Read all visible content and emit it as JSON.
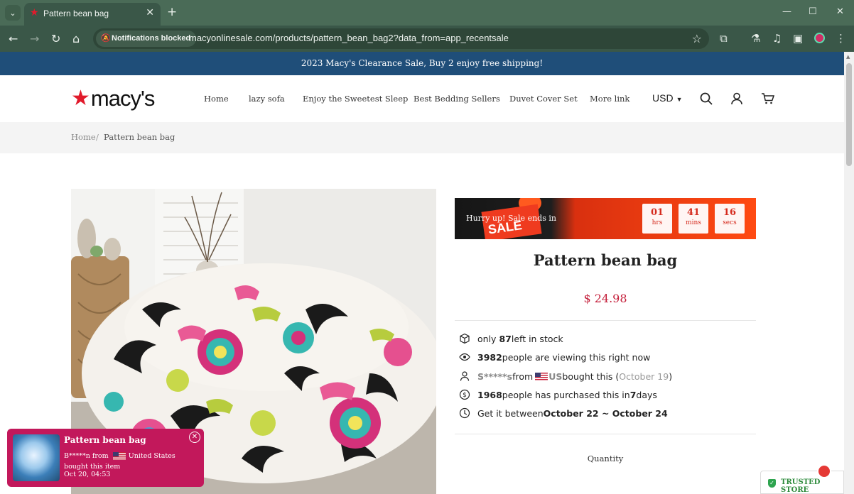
{
  "browser": {
    "tab_title": "Pattern bean bag",
    "notifications_chip": "Notifications blocked",
    "url": "macyonlinesale.com/products/pattern_bean_bag2?data_from=app_recentsale"
  },
  "announcement": "2023 Macy's Clearance Sale, Buy 2 enjoy free shipping!",
  "header": {
    "logo_text": "macy's",
    "nav": [
      "Home",
      "lazy sofa",
      "Enjoy the Sweetest Sleep",
      "Best Bedding Sellers",
      "Duvet Cover Set",
      "More link"
    ],
    "currency": "USD"
  },
  "breadcrumb": {
    "home": "Home",
    "separator": "/",
    "current": "Pattern bean bag"
  },
  "countdown": {
    "text": "Hurry up!  Sale ends in",
    "sale_word": "SALE",
    "hours": "01",
    "hours_label": "hrs",
    "mins": "41",
    "mins_label": "mins",
    "secs": "16",
    "secs_label": "secs"
  },
  "product": {
    "title": "Pattern bean bag",
    "price": "$ 24.98",
    "quantity_label": "Quantity"
  },
  "info": {
    "stock_pre": "only ",
    "stock_count": "87",
    "stock_post": " left in stock",
    "viewers_count": "3982",
    "viewers_post": " people are viewing this right now",
    "buyer_name": "S*****s",
    "buyer_from": " from ",
    "buyer_country": "US",
    "buyer_post": " bought this (",
    "buyer_date": "October 19",
    "buyer_close": ")",
    "purchased_count": "1968",
    "purchased_mid": " people has purchased this in ",
    "purchased_days": "7",
    "purchased_post": " days",
    "delivery_pre": "Get it between ",
    "delivery_range": "October 22 ~ October 24"
  },
  "popup": {
    "title": "Pattern bean bag",
    "buyer": "B*****n from",
    "text": "United States bought this item",
    "time": "Oct 20, 04:53"
  },
  "trusted_store": "TRUSTED STORE",
  "colors": {
    "announcement_bg": "#1f4e79",
    "price": "#c41e3a",
    "popup_bg": "#c2185b",
    "logo_star": "#e11a2b"
  }
}
